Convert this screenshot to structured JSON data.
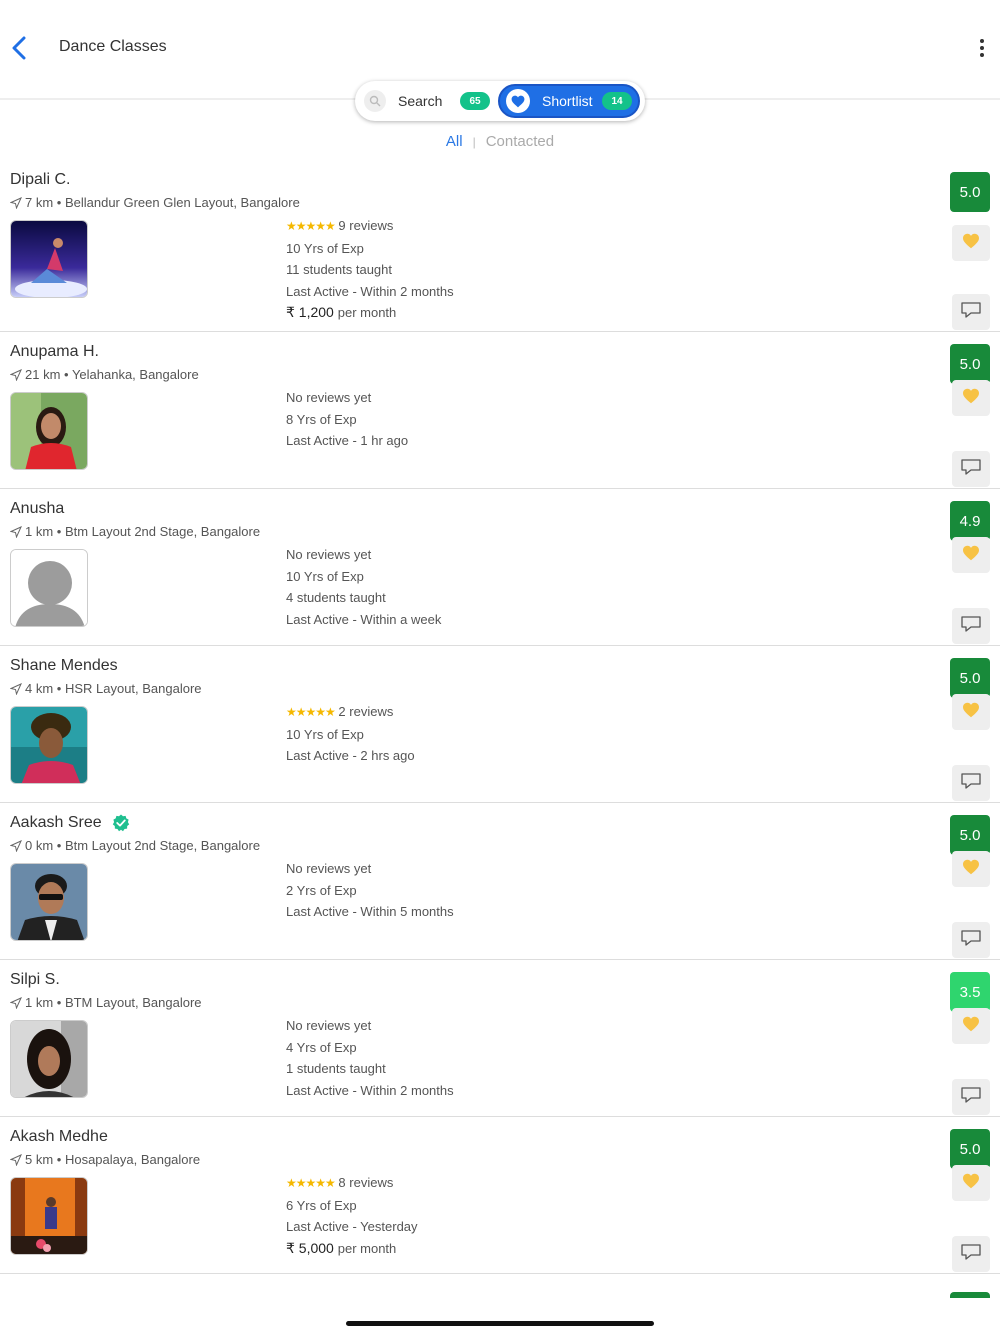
{
  "header": {
    "title": "Dance Classes"
  },
  "segments": {
    "search_label": "Search",
    "search_count": "65",
    "shortlist_label": "Shortlist",
    "shortlist_count": "14"
  },
  "filters": {
    "all": "All",
    "separator": "|",
    "contacted": "Contacted"
  },
  "colors": {
    "accent": "#1f6fe5",
    "rating_green": "#188a3a",
    "rating_light": "#2fd56e",
    "heart": "#f7c244",
    "badge": "#13c28a"
  },
  "tutors": [
    {
      "name": "Dipali C.",
      "verified": false,
      "location": "7 km • Bellandur Green Glen Layout, Bangalore",
      "rating": "5.0",
      "rating_tier": "dark",
      "stars": "★★★★★",
      "reviews": "9 reviews",
      "lines": [
        "10 Yrs of Exp",
        "11 students taught",
        "Last Active - Within 2 months"
      ],
      "price": {
        "amount": "₹ 1,200",
        "unit": "per month"
      },
      "photo": "stage-dancer"
    },
    {
      "name": "Anupama  H.",
      "verified": false,
      "location": "21 km • Yelahanka, Bangalore",
      "rating": "5.0",
      "rating_tier": "dark",
      "reviews_none": "No reviews yet",
      "lines": [
        "8 Yrs of Exp",
        "Last Active - 1 hr ago"
      ],
      "photo": "woman-red"
    },
    {
      "name": "Anusha",
      "verified": false,
      "location": "1 km • Btm Layout 2nd Stage, Bangalore",
      "rating": "4.9",
      "rating_tier": "dark",
      "reviews_none": "No reviews yet",
      "lines": [
        "10 Yrs of Exp",
        "4 students taught",
        "Last Active - Within a week"
      ],
      "photo": "placeholder-avatar"
    },
    {
      "name": "Shane Mendes",
      "verified": false,
      "location": "4 km • HSR Layout, Bangalore",
      "rating": "5.0",
      "rating_tier": "dark",
      "stars": "★★★★★",
      "reviews": "2 reviews",
      "lines": [
        "10 Yrs of Exp",
        "Last Active - 2 hrs ago"
      ],
      "photo": "man-dreadlocks"
    },
    {
      "name": "Aakash Sree",
      "verified": true,
      "location": "0 km • Btm Layout 2nd Stage, Bangalore",
      "rating": "5.0",
      "rating_tier": "dark",
      "reviews_none": "No reviews yet",
      "lines": [
        "2 Yrs of Exp",
        "Last Active - Within 5 months"
      ],
      "photo": "man-sunglasses"
    },
    {
      "name": "Silpi S.",
      "verified": false,
      "location": "1 km • BTM Layout, Bangalore",
      "rating": "3.5",
      "rating_tier": "light",
      "reviews_none": "No reviews yet",
      "lines": [
        "4 Yrs of Exp",
        "1 students taught",
        "Last Active - Within 2 months"
      ],
      "photo": "woman-selfie"
    },
    {
      "name": "Akash Medhe",
      "verified": false,
      "location": "5 km • Hosapalaya, Bangalore",
      "rating": "5.0",
      "rating_tier": "dark",
      "stars": "★★★★★",
      "reviews": "8 reviews",
      "lines": [
        "6 Yrs of Exp",
        "Last Active - Yesterday"
      ],
      "price": {
        "amount": "₹ 5,000",
        "unit": "per month"
      },
      "photo": "stage-performer"
    }
  ]
}
